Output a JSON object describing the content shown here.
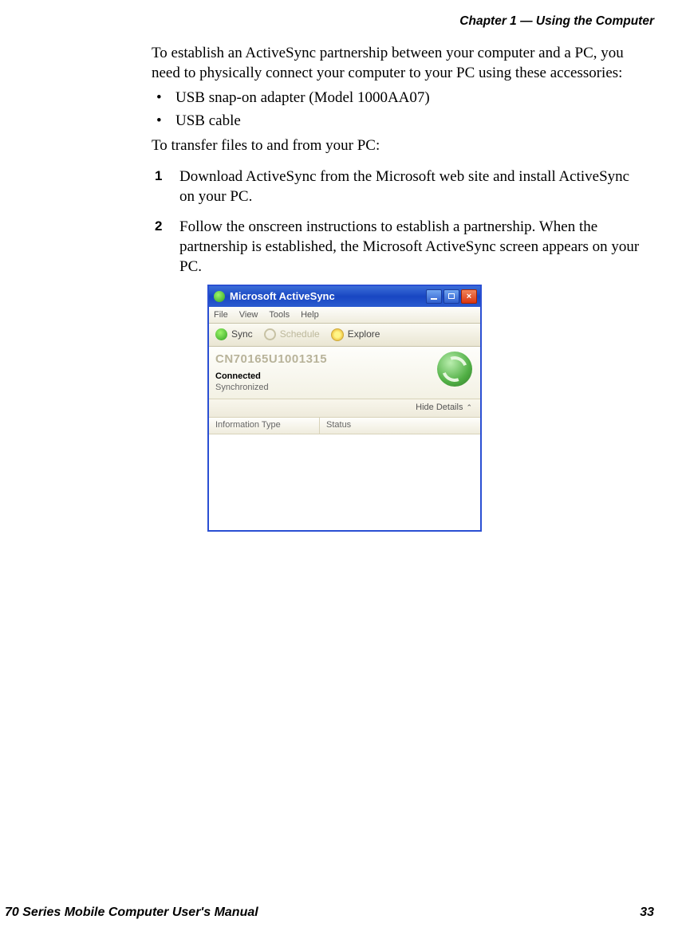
{
  "header": {
    "chapter": "Chapter 1 — Using the Computer"
  },
  "body": {
    "intro": "To establish an ActiveSync partnership between your computer and a PC, you need to physically connect your computer to your PC using these accessories:",
    "bullets": [
      "USB snap-on adapter (Model 1000AA07)",
      "USB cable"
    ],
    "intro2": "To transfer files to and from your PC:",
    "steps": [
      {
        "num": "1",
        "text": "Download ActiveSync from the Microsoft web site and install ActiveSync on your PC."
      },
      {
        "num": "2",
        "text": "Follow the onscreen instructions to establish a partnership. When the partnership is established, the Microsoft ActiveSync screen appears on your PC."
      }
    ]
  },
  "activesync": {
    "title": "Microsoft ActiveSync",
    "menus": [
      "File",
      "View",
      "Tools",
      "Help"
    ],
    "toolbar": {
      "sync": "Sync",
      "schedule": "Schedule",
      "explore": "Explore"
    },
    "device_name": "CN70165U1001315",
    "connected_label": "Connected",
    "sync_label": "Synchronized",
    "hide_details": "Hide Details",
    "columns": {
      "info": "Information Type",
      "status": "Status"
    }
  },
  "footer": {
    "manual": "70 Series Mobile Computer User's Manual",
    "page": "33"
  }
}
